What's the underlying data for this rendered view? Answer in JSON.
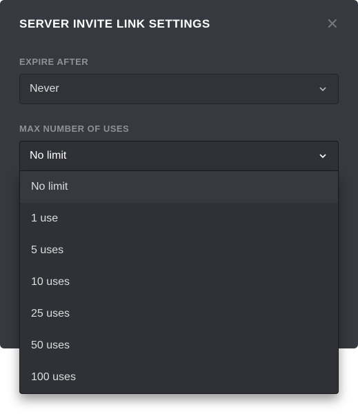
{
  "modal": {
    "title": "SERVER INVITE LINK SETTINGS"
  },
  "expire": {
    "label": "EXPIRE AFTER",
    "value": "Never"
  },
  "maxUses": {
    "label": "MAX NUMBER OF USES",
    "value": "No limit",
    "options": [
      "No limit",
      "1 use",
      "5 uses",
      "10 uses",
      "25 uses",
      "50 uses",
      "100 uses"
    ]
  }
}
